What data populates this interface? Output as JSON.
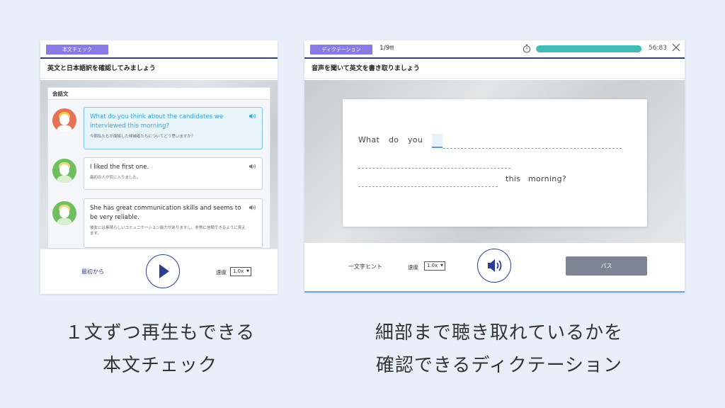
{
  "left": {
    "tag": "本文チェック",
    "instruction": "英文と日本語訳を確認してみましょう",
    "conversation_header": "会話文",
    "messages": [
      {
        "en": "What do you think about the candidates we interviewed this morning?",
        "ja": "今朝私たちが面接した候補者たちについてどう思いますか？",
        "active": true,
        "avatar": "red"
      },
      {
        "en": "I liked the first one.",
        "ja": "最初の人が気に入りました。",
        "active": false,
        "avatar": "green"
      },
      {
        "en": "She has great communication skills and seems to be very reliable.",
        "ja": "彼女には素晴らしいコミュニケーション能力がありますし、非常に信頼できるように見えます。",
        "active": false,
        "avatar": "green"
      }
    ],
    "controls": {
      "from_start": "最初から",
      "speed_label": "速度",
      "speed_value": "1.0x"
    }
  },
  "right": {
    "tag": "ディクテーション",
    "counter": "1/9",
    "counter_unit": "問",
    "progress": 0.98,
    "timer": "56:83",
    "instruction": "音声を聞いて英文を書き取りましょう",
    "words": {
      "w1": "What",
      "w2": "do",
      "w3": "you",
      "w4": "this",
      "w5": "morning?"
    },
    "controls": {
      "hint": "一文字ヒント",
      "speed_label": "速度",
      "speed_value": "1.0x",
      "pass": "パス"
    }
  },
  "captions": {
    "left_line1": "１文ずつ再生もできる",
    "left_line2": "本文チェック",
    "right_line1": "細部まで聴き取れているかを",
    "right_line2": "確認できるディクテーション"
  },
  "colors": {
    "accent": "#2d3f8c",
    "tag": "#8a7ae3",
    "progress": "#45bab5",
    "active_text": "#3aa6d6"
  }
}
